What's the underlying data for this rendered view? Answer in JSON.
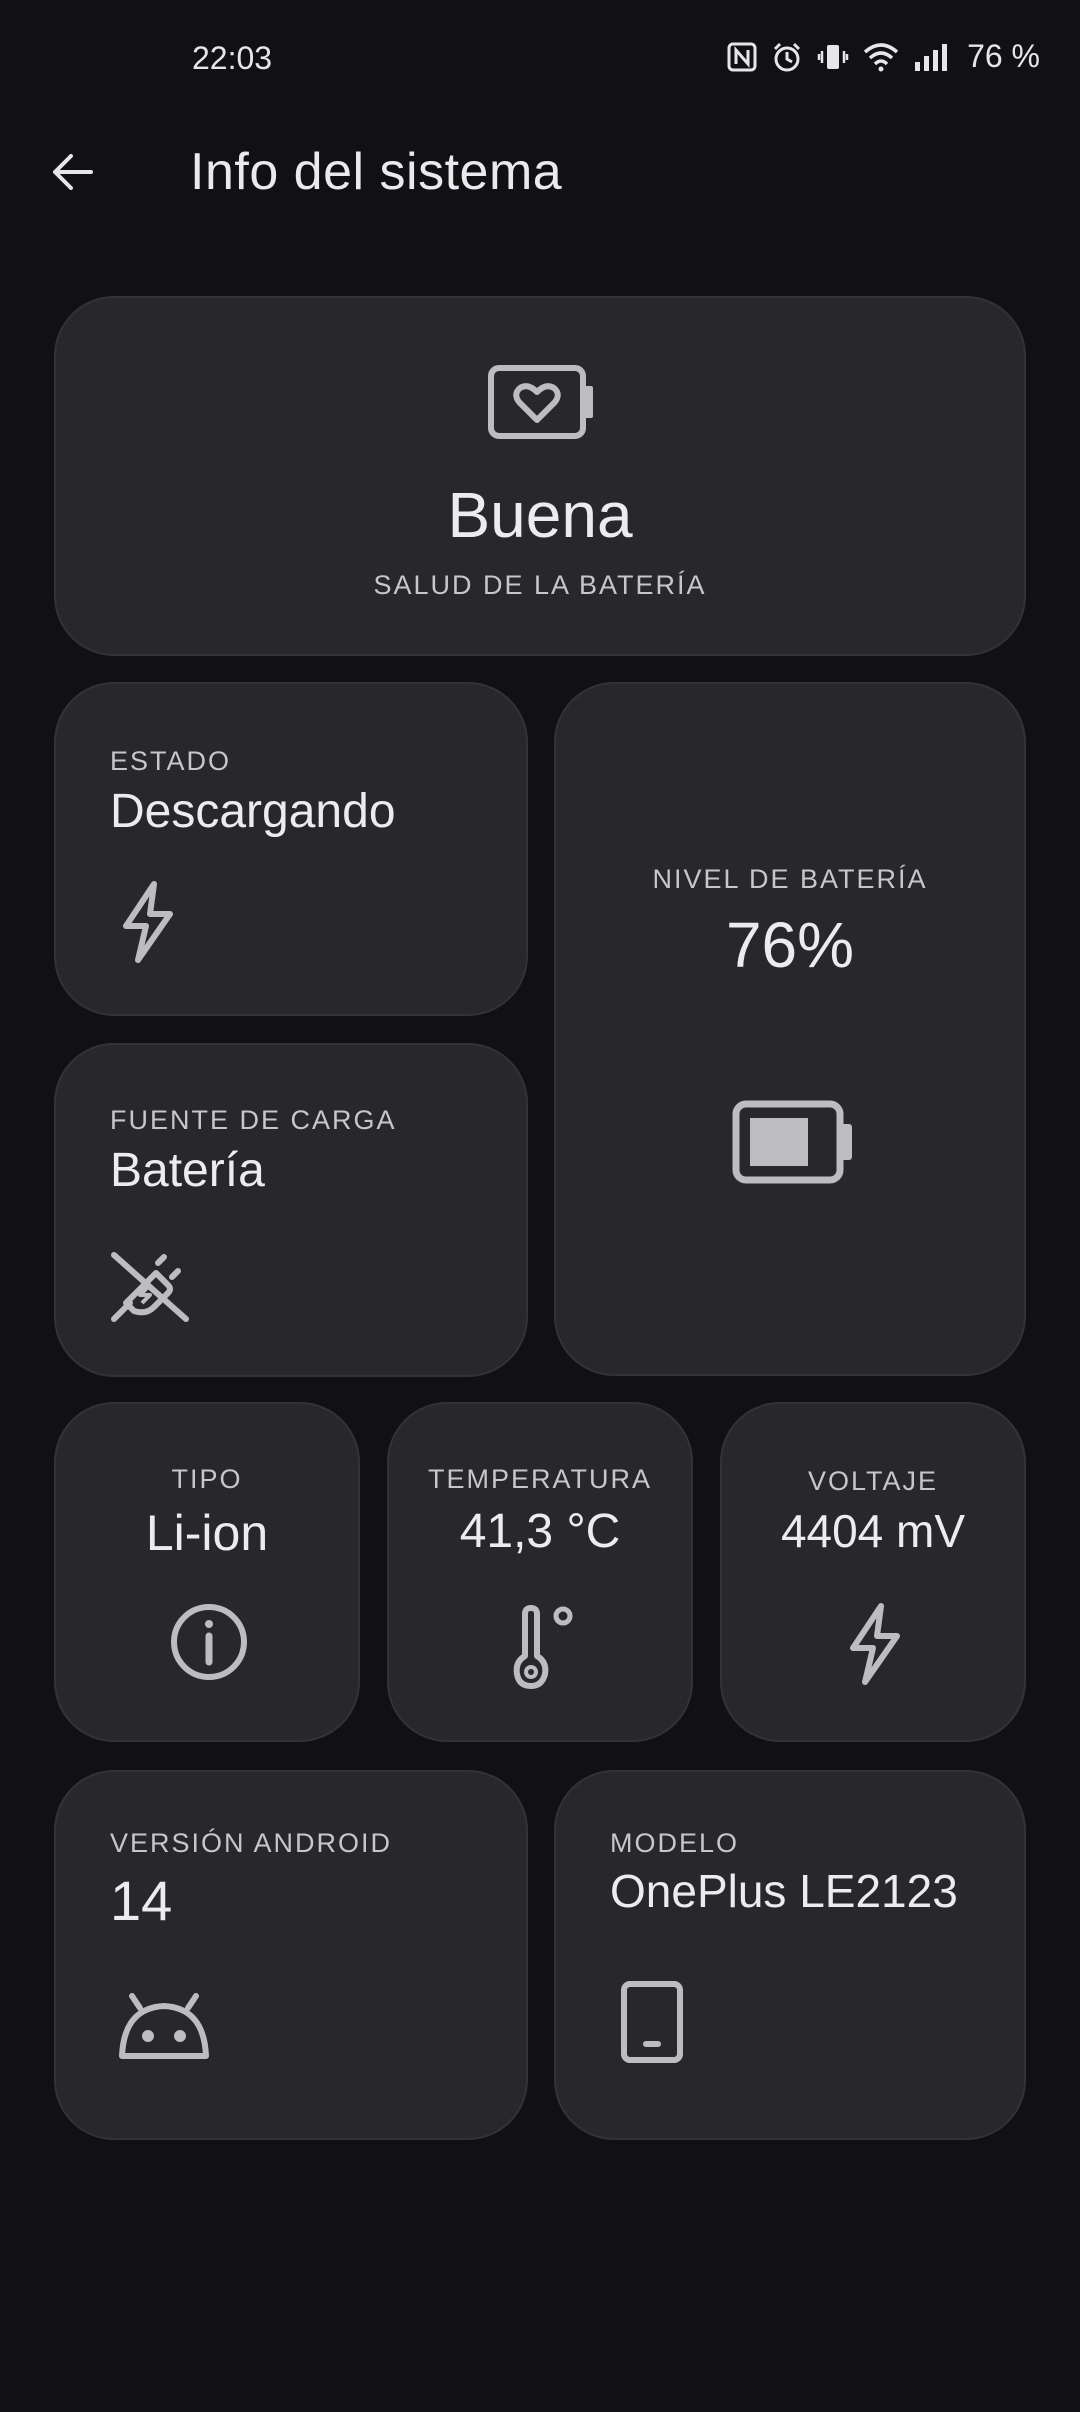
{
  "status_bar": {
    "time": "22:03",
    "battery_text": "76 %",
    "icons": [
      "nfc-icon",
      "alarm-icon",
      "vibrate-icon",
      "wifi-icon",
      "signal-icon"
    ]
  },
  "app_bar": {
    "title": "Info del sistema",
    "back_icon": "arrow-left-icon"
  },
  "cards": {
    "health": {
      "value": "Buena",
      "label": "SALUD DE LA BATERÍA",
      "icon": "battery-heart-icon"
    },
    "status": {
      "label": "ESTADO",
      "value": "Descargando",
      "icon": "bolt-icon"
    },
    "level": {
      "label": "NIVEL DE BATERÍA",
      "value": "76%",
      "icon": "battery-icon",
      "fill": 0.76
    },
    "source": {
      "label": "FUENTE DE CARGA",
      "value": "Batería",
      "icon": "unplugged-icon"
    },
    "type": {
      "label": "TIPO",
      "value": "Li-ion",
      "icon": "info-icon"
    },
    "temperature": {
      "label": "TEMPERATURA",
      "value": "41,3 °C",
      "icon": "thermometer-icon"
    },
    "voltage": {
      "label": "VOLTAJE",
      "value": "4404 mV",
      "icon": "bolt-icon"
    },
    "android": {
      "label": "VERSIÓN ANDROID",
      "value": "14",
      "icon": "android-icon"
    },
    "model": {
      "label": "MODELO",
      "value": "OnePlus LE2123",
      "icon": "phone-icon"
    }
  },
  "colors": {
    "background": "#111113",
    "card": "#28282b",
    "text": "#ececef",
    "icon": "#bdbdc0"
  }
}
